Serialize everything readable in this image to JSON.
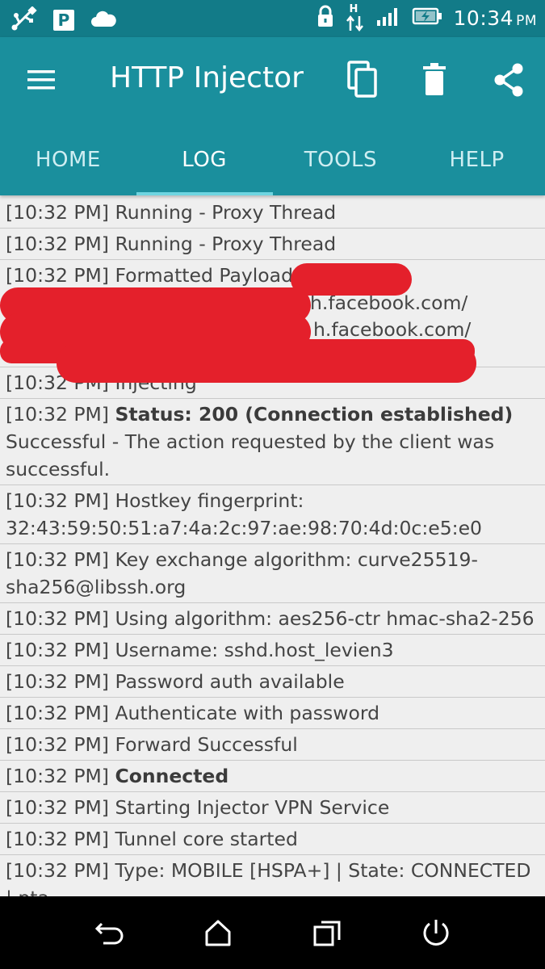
{
  "status_bar": {
    "time": "10:34",
    "ampm": "PM",
    "left_icons": [
      "usb-icon",
      "parking-icon",
      "cloud-icon"
    ],
    "right_icons": [
      "lock-icon",
      "hspa-icon",
      "signal-icon",
      "battery-charging-icon"
    ],
    "parking_letter": "P",
    "network_letter": "H"
  },
  "app_bar": {
    "title": "HTTP Injector",
    "actions": [
      "copy-icon",
      "delete-icon",
      "share-icon"
    ]
  },
  "tabs": [
    {
      "label": "HOME",
      "active": false
    },
    {
      "label": "LOG",
      "active": true
    },
    {
      "label": "TOOLS",
      "active": false
    },
    {
      "label": "HELP",
      "active": false
    }
  ],
  "log": [
    {
      "time": "[10:32 PM]",
      "text": "Running - Proxy Thread"
    },
    {
      "time": "[10:32 PM]",
      "text": "Running - Proxy Thread"
    },
    {
      "time": "[10:32 PM]",
      "text": "Formatted Payload",
      "extra_lines": [
        "h.facebook.com/",
        "h.facebook.com/"
      ],
      "redacted": true
    },
    {
      "time": "[10:32 PM]",
      "text": "Injecting"
    },
    {
      "time": "[10:32 PM]",
      "bold": "Status: 200 (Connection established)",
      "text": "Successful - The action requested by the client was successful."
    },
    {
      "time": "[10:32 PM]",
      "text": "Hostkey fingerprint: 32:43:59:50:51:a7:4a:2c:97:ae:98:70:4d:0c:e5:e0"
    },
    {
      "time": "[10:32 PM]",
      "text": "Key exchange algorithm: curve25519-sha256@libssh.org"
    },
    {
      "time": "[10:32 PM]",
      "text": "Using algorithm: aes256-ctr hmac-sha2-256"
    },
    {
      "time": "[10:32 PM]",
      "text": "Username: sshd.host_levien3"
    },
    {
      "time": "[10:32 PM]",
      "text": "Password auth available"
    },
    {
      "time": "[10:32 PM]",
      "text": "Authenticate with password"
    },
    {
      "time": "[10:32 PM]",
      "text": "Forward Successful"
    },
    {
      "time": "[10:32 PM]",
      "bold": "Connected"
    },
    {
      "time": "[10:32 PM]",
      "text": "Starting Injector VPN Service"
    },
    {
      "time": "[10:32 PM]",
      "text": "Tunnel core started"
    },
    {
      "time": "[10:32 PM]",
      "text": "Type: MOBILE [HSPA+] | State: CONNECTED | pta"
    }
  ],
  "nav_bar": {
    "buttons": [
      "back-icon",
      "home-icon",
      "recents-icon",
      "power-icon"
    ]
  },
  "colors": {
    "status_bar": "#127b88",
    "app_bar": "#1a8f9d",
    "tab_indicator": "#6fd5e0",
    "log_background": "#efefef",
    "redaction": "#e4202b"
  }
}
